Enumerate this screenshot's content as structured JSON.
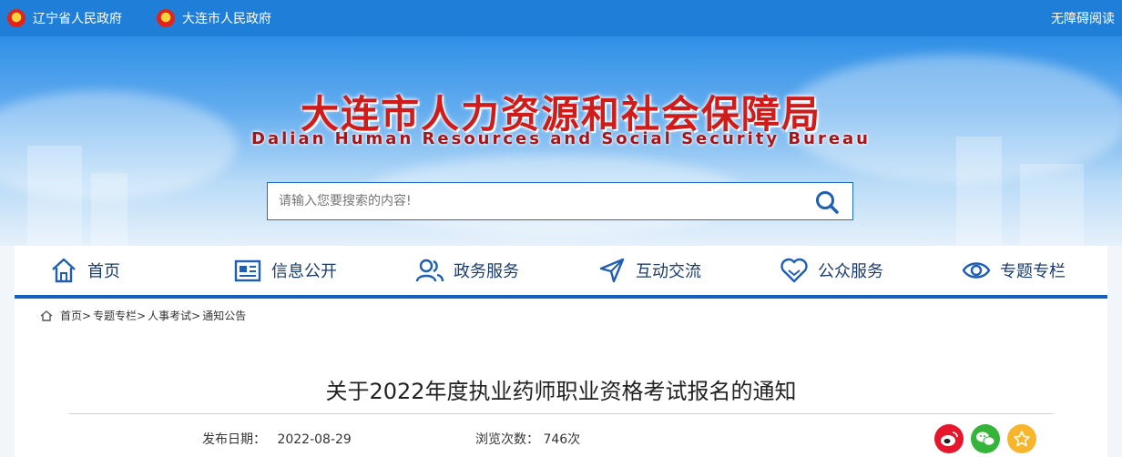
{
  "topbar": {
    "links": [
      "辽宁省人民政府",
      "大连市人民政府"
    ],
    "accessibility": "无障碍阅读"
  },
  "header": {
    "title_cn": "大连市人力资源和社会保障局",
    "title_en": "Dalian Human Resources and Social Security Bureau"
  },
  "search": {
    "placeholder": "请输入您要搜索的内容!"
  },
  "nav": {
    "items": [
      {
        "label": "首页",
        "icon": "home-icon"
      },
      {
        "label": "信息公开",
        "icon": "news-icon"
      },
      {
        "label": "政务服务",
        "icon": "users-icon"
      },
      {
        "label": "互动交流",
        "icon": "send-icon"
      },
      {
        "label": "公众服务",
        "icon": "heart-icon"
      },
      {
        "label": "专题专栏",
        "icon": "eye-icon"
      }
    ]
  },
  "breadcrumb": [
    "首页>",
    "专题专栏>",
    "人事考试>",
    "通知公告"
  ],
  "article": {
    "title": "关于2022年度执业药师职业资格考试报名的通知",
    "date_label": "发布日期：",
    "date": "2022-08-29",
    "views_label": "浏览次数：",
    "views": "746次"
  },
  "share": [
    {
      "icon": "weibo-icon",
      "color": "#e6162d"
    },
    {
      "icon": "wechat-icon",
      "color": "#35b43a"
    },
    {
      "icon": "star-icon",
      "color": "#f7b52c"
    }
  ],
  "colors": {
    "topbar": "#1f7fd8",
    "nav_accent": "#1560bd",
    "title_red": "#d01b1b"
  }
}
